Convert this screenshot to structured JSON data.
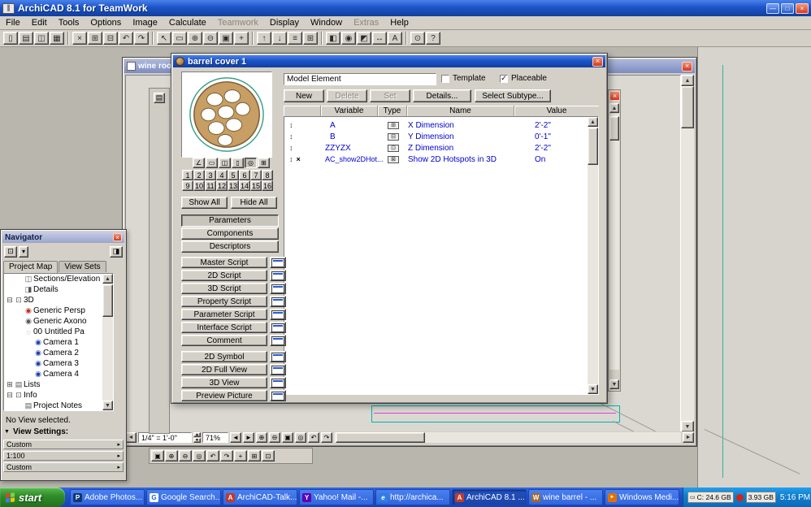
{
  "ui": {
    "close": "×",
    "min": "—",
    "max": "□",
    "up": "▲",
    "down": "▼",
    "left": "◄",
    "right": "►",
    "check": "✓",
    "arrow": "▸",
    "vs_toggle": "▼"
  },
  "titlebar": {
    "title": "ArchiCAD 8.1 for TeamWork"
  },
  "menubar": {
    "items": [
      "File",
      "Edit",
      "Tools",
      "Options",
      "Image",
      "Calculate",
      "Teamwork",
      "Display",
      "Window",
      "Extras",
      "Help"
    ]
  },
  "toolbar": {
    "icons": [
      {
        "name": "new",
        "g": "▯"
      },
      {
        "name": "open",
        "g": "▤"
      },
      {
        "name": "save",
        "g": "◫"
      },
      {
        "name": "print",
        "g": "▦"
      },
      {
        "name": "cut",
        "g": "×"
      },
      {
        "name": "copy",
        "g": "⊞"
      },
      {
        "name": "paste",
        "g": "⊟"
      },
      {
        "name": "undo",
        "g": "↶"
      },
      {
        "name": "redo",
        "g": "↷"
      },
      {
        "name": "pointer",
        "g": "↖"
      },
      {
        "name": "marquee",
        "g": "▭"
      },
      {
        "name": "zoom-in",
        "g": "⊕"
      },
      {
        "name": "zoom-out",
        "g": "⊖"
      },
      {
        "name": "fit-view",
        "g": "▣"
      },
      {
        "name": "pan",
        "g": "+"
      },
      {
        "name": "story-up",
        "g": "↑"
      },
      {
        "name": "story-down",
        "g": "↓"
      },
      {
        "name": "layers",
        "g": "≡"
      },
      {
        "name": "grid",
        "g": "⊞"
      },
      {
        "name": "3d-window",
        "g": "◧"
      },
      {
        "name": "camera",
        "g": "◉"
      },
      {
        "name": "section",
        "g": "◩"
      },
      {
        "name": "dimension",
        "g": "↔"
      },
      {
        "name": "text",
        "g": "A"
      },
      {
        "name": "zoom-percent",
        "g": "⊙"
      },
      {
        "name": "help",
        "g": "?"
      }
    ]
  },
  "windows": {
    "wine": {
      "title": "wine roo...",
      "scale": "1/4\" = 1'-0\"",
      "zoom": "71%",
      "nav_icons": [
        {
          "name": "pan-left",
          "g": "◄"
        },
        {
          "name": "pan-right",
          "g": "►"
        },
        {
          "name": "zoom-in",
          "g": "⊕"
        },
        {
          "name": "zoom-out",
          "g": "⊖"
        },
        {
          "name": "fit-view",
          "g": "▣"
        },
        {
          "name": "orbit",
          "g": "◎"
        },
        {
          "name": "previous-view",
          "g": "↶"
        },
        {
          "name": "next-view",
          "g": "↷"
        }
      ]
    },
    "inner": {
      "icons": [
        {
          "name": "fit-view",
          "g": "▣"
        },
        {
          "name": "zoom-in",
          "g": "⊕"
        },
        {
          "name": "zoom-out",
          "g": "⊖"
        },
        {
          "name": "orbit",
          "g": "◎"
        },
        {
          "name": "previous-view",
          "g": "↶"
        },
        {
          "name": "next-view",
          "g": "↷"
        },
        {
          "name": "pan",
          "g": "+"
        },
        {
          "name": "grid",
          "g": "⊞"
        },
        {
          "name": "home",
          "g": "⊡"
        }
      ]
    }
  },
  "dialog": {
    "title": "barrel cover 1",
    "subtype_field": "Model Element",
    "template_label": "Template",
    "placeable_label": "Placeable",
    "buttons": {
      "new": "New",
      "del": "Delete",
      "set": "Set",
      "details": "Details...",
      "select_subtype": "Select Subtype..."
    },
    "icons": {
      "updown": "↕",
      "x": "×"
    },
    "table": {
      "headers": [
        "Variable",
        "Type",
        "Name",
        "Value"
      ],
      "rows": [
        {
          "variable": "A",
          "t": "⊞",
          "name": "X Dimension",
          "value": "2'-2\""
        },
        {
          "variable": "B",
          "t": "⊟",
          "name": "Y Dimension",
          "value": "0'-1\""
        },
        {
          "variable": "ZZYZX",
          "t": "⊡",
          "name": "Z Dimension",
          "value": "2'-2\""
        },
        {
          "variable": "AC_show2DHot...",
          "t": "⊠",
          "name": "Show 2D Hotspots in 3D",
          "value": "On"
        }
      ]
    },
    "toggles": [
      {
        "name": "hotspots-toggle",
        "g": "∠"
      },
      {
        "name": "plan-toggle",
        "g": "▭"
      },
      {
        "name": "front-view-toggle",
        "g": "◫"
      },
      {
        "name": "side-view-toggle",
        "g": "▯"
      },
      {
        "name": "preview-toggle",
        "g": "◎"
      },
      {
        "name": "grid-toggle",
        "g": "⊞"
      }
    ],
    "numbers": [
      "1",
      "2",
      "3",
      "4",
      "5",
      "6",
      "7",
      "8",
      "9",
      "10",
      "11",
      "12",
      "13",
      "14",
      "15",
      "16"
    ],
    "show_all": "Show All",
    "hide_all": "Hide All",
    "sections": [
      "Parameters",
      "Components",
      "Descriptors"
    ],
    "scripts": [
      "Master Script",
      "2D Script",
      "3D Script",
      "Property Script",
      "Parameter Script",
      "Interface Script",
      "Comment"
    ],
    "views": [
      "2D Symbol",
      "2D Full View",
      "3D View",
      "Preview Picture"
    ]
  },
  "navigator": {
    "title": "Navigator",
    "tools": [
      {
        "name": "project-chooser",
        "g": "⊡"
      },
      {
        "name": "map-dropdown",
        "g": "▾"
      },
      {
        "name": "palette-menu",
        "g": "◨"
      }
    ],
    "tabs": [
      "Project Map",
      "View Sets"
    ],
    "tree": [
      {
        "exp": "",
        "g": "◫",
        "label": "Sections/Elevation"
      },
      {
        "exp": "",
        "g": "◨",
        "label": "Details"
      },
      {
        "exp": "⊟",
        "g": "⊡",
        "label": "3D"
      },
      {
        "exp": "",
        "g": "◉",
        "label": "Generic Persp"
      },
      {
        "exp": "",
        "g": "◉",
        "label": "Generic Axono"
      },
      {
        "exp": "",
        "g": "◌",
        "label": "00 Untitled Pa"
      },
      {
        "exp": "",
        "g": "◉",
        "label": "Camera 1"
      },
      {
        "exp": "",
        "g": "◉",
        "label": "Camera 2"
      },
      {
        "exp": "",
        "g": "◉",
        "label": "Camera 3"
      },
      {
        "exp": "",
        "g": "◉",
        "label": "Camera 4"
      },
      {
        "exp": "⊞",
        "g": "▤",
        "label": "Lists"
      },
      {
        "exp": "⊟",
        "g": "⊡",
        "label": "Info"
      },
      {
        "exp": "",
        "g": "▤",
        "label": "Project Notes"
      }
    ],
    "status": "No View selected.",
    "view_settings": "View Settings:",
    "settings": [
      "Custom",
      "1:100",
      "Custom"
    ]
  },
  "taskbar": {
    "start": "start",
    "tasks": [
      {
        "label": "Adobe Photos...",
        "ic": "P"
      },
      {
        "label": "Google Search...",
        "ic": "G"
      },
      {
        "label": "ArchiCAD-Talk...",
        "ic": "A"
      },
      {
        "label": "Yahoo! Mail -...",
        "ic": "Y"
      },
      {
        "label": "http://archica...",
        "ic": "e"
      },
      {
        "label": "ArchiCAD 8.1 ...",
        "ic": "A"
      },
      {
        "label": "wine barrel - ...",
        "ic": "W"
      },
      {
        "label": "Windows Medi...",
        "ic": "►"
      }
    ],
    "tray": {
      "disk": "C: 24.6 GB",
      "ram": "3.93 GB",
      "time": "5:16 PM"
    }
  }
}
